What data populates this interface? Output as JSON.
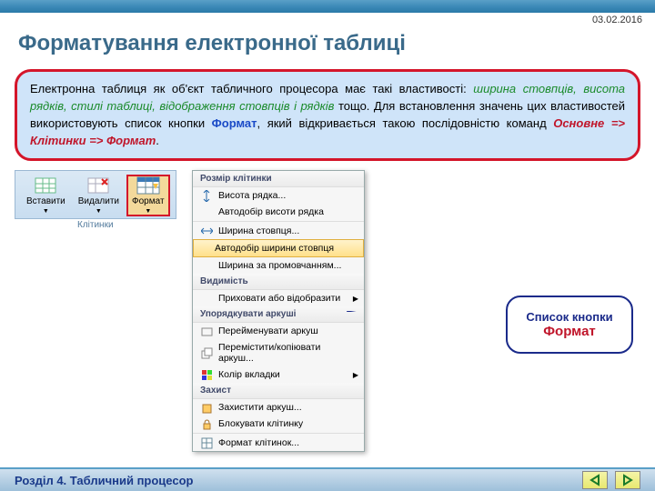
{
  "date": "03.02.2016",
  "title": "Форматування електронної таблиці",
  "info": {
    "t1": "Електронна таблиця як об'єкт табличного процесора має такі властивості: ",
    "props": "ширина стовпців, висота рядків, стилі таблиці, відображення стовпців і рядків",
    "t2": " тощо. Для встановлення значень цих властивостей використовують список кнопки ",
    "btn": "Формат",
    "t3": ", який відкривається такою послідовністю команд ",
    "path1": "Основне",
    "arrow": " => ",
    "path2": "Клітинки",
    "path3": "Формат",
    "t4": "."
  },
  "ribbon": {
    "insert": "Вставити",
    "delete": "Видалити",
    "format": "Формат",
    "group": "Клітинки"
  },
  "menu": {
    "s1": "Розмір клітинки",
    "i1": "Висота рядка...",
    "i2": "Автодобір висоти рядка",
    "i3": "Ширина стовпця...",
    "i4": "Автодобір ширини стовпця",
    "i5": "Ширина за промовчанням...",
    "s2": "Видимість",
    "i6": "Приховати або відобразити",
    "s3": "Упорядкувати аркуші",
    "i7": "Перейменувати аркуш",
    "i8": "Перемістити/копіювати аркуш...",
    "i9": "Колір вкладки",
    "s4": "Захист",
    "i10": "Захистити аркуш...",
    "i11": "Блокувати клітинку",
    "i12": "Формат клітинок..."
  },
  "callout": {
    "l1": "Список кнопки",
    "l2": "Формат"
  },
  "footer": "Розділ 4. Табличний процесор"
}
